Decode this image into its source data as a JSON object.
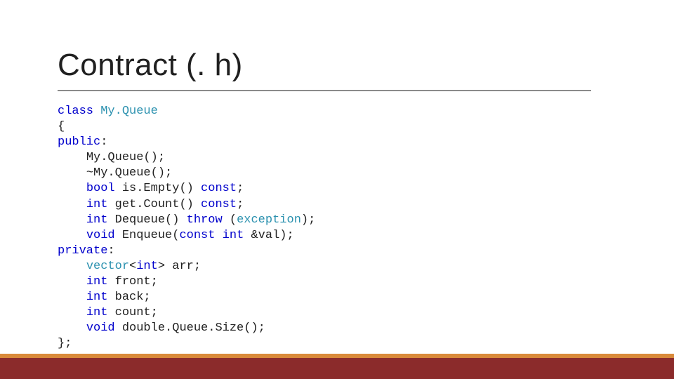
{
  "title": "Contract (. h)",
  "code": {
    "l1": {
      "kw_class": "class",
      "sp1": " ",
      "cls_name": "My.Queue"
    },
    "l2": {
      "brace": "{"
    },
    "l3": {
      "kw_public": "public",
      "colon": ":"
    },
    "l4": {
      "indent": "    ",
      "ctor": "My.Queue();"
    },
    "l5": {
      "indent": "    ",
      "dtor": "~My.Queue();"
    },
    "l6": {
      "indent": "    ",
      "kw_bool": "bool",
      "sp": " ",
      "fn": "is.Empty() ",
      "kw_const": "const",
      "semi": ";"
    },
    "l7": {
      "indent": "    ",
      "kw_int": "int",
      "sp": " ",
      "fn": "get.Count() ",
      "kw_const": "const",
      "semi": ";"
    },
    "l8": {
      "indent": "    ",
      "kw_int": "int",
      "sp": " ",
      "fn": "Dequeue() ",
      "kw_throw": "throw",
      "sp2": " (",
      "cls_exc": "exception",
      "close": ");"
    },
    "l9": {
      "indent": "    ",
      "kw_void": "void",
      "sp": " ",
      "fn": "Enqueue(",
      "kw_const": "const",
      "sp2": " ",
      "kw_int2": "int",
      "sp3": " &val);"
    },
    "l10": {
      "kw_private": "private",
      "colon": ":"
    },
    "l11": {
      "indent": "    ",
      "cls_vec": "vector",
      "open": "<",
      "kw_int": "int",
      "close": "> arr;"
    },
    "l12": {
      "indent": "    ",
      "kw_int": "int",
      "rest": " front;"
    },
    "l13": {
      "indent": "    ",
      "kw_int": "int",
      "rest": " back;"
    },
    "l14": {
      "indent": "    ",
      "kw_int": "int",
      "rest": " count;"
    },
    "l15": {
      "indent": "    ",
      "kw_void": "void",
      "rest": " double.Queue.Size();"
    },
    "l16": {
      "close": "};"
    }
  }
}
